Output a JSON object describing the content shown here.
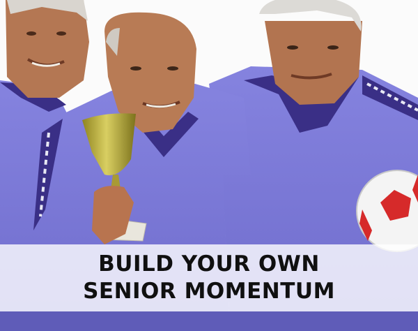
{
  "headline": {
    "line1": "BUILD YOUR OWN",
    "line2": "SENIOR MOMENTUM"
  },
  "colors": {
    "jersey": "#7a78d8",
    "jersey_dark": "#3a2f86",
    "skin": "#b77a55",
    "trophy_gold": "#b4a832",
    "ball_red": "#d62a2a",
    "banner_text": "#101010"
  },
  "photo": {
    "subject_count": 3,
    "props": [
      "trophy-icon",
      "soccer-ball-icon"
    ]
  }
}
